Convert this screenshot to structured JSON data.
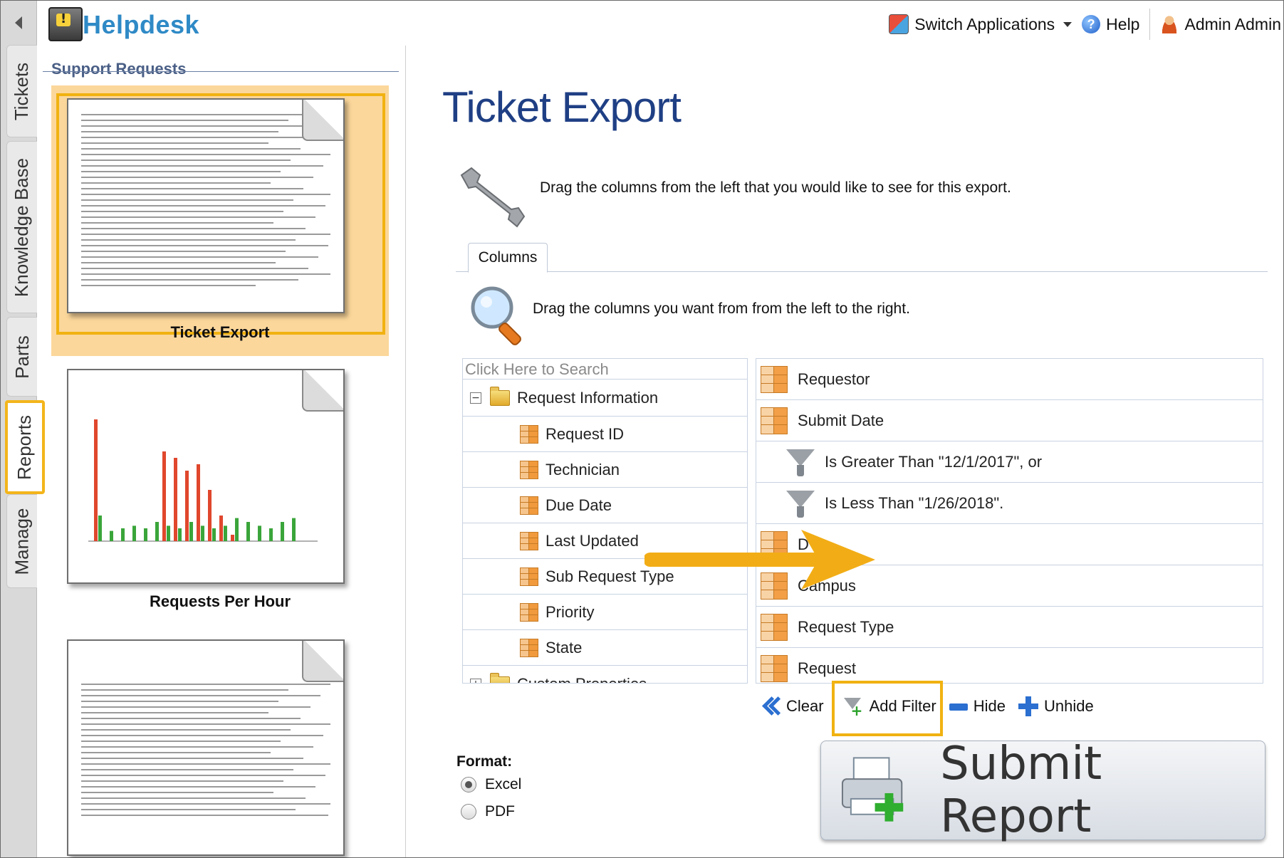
{
  "app": {
    "title": "Helpdesk"
  },
  "header": {
    "switch_applications": "Switch Applications",
    "help": "Help",
    "user": "Admin Admin"
  },
  "nav_tabs": [
    "Tickets",
    "Knowledge Base",
    "Parts",
    "Reports",
    "Manage"
  ],
  "active_tab": "Reports",
  "reports_pane": {
    "section_title": "Support Requests",
    "reports": [
      {
        "label": "Ticket Export",
        "selected": true
      },
      {
        "label": "Requests Per Hour",
        "selected": false
      },
      {
        "label": "",
        "selected": false
      }
    ]
  },
  "main": {
    "title": "Ticket Export",
    "instruction": "Drag the columns from the left that you would like to see for this export.",
    "tab_columns": "Columns",
    "columns_instruction": "Drag the columns you want from from the left to the right.",
    "search_placeholder": "Click Here to Search",
    "tree": {
      "group_expanded": "Request Information",
      "fields": [
        "Request ID",
        "Technician",
        "Due Date",
        "Last Updated",
        "Sub Request Type",
        "Priority",
        "State"
      ],
      "group_collapsed": "Custom Properties"
    },
    "selected_columns": {
      "requestor": "Requestor",
      "submit_date": "Submit Date",
      "filter1": "Is Greater Than \"12/1/2017\", or",
      "filter2": "Is Less Than \"1/26/2018\".",
      "hidden_row": "D",
      "campus": "Campus",
      "request_type": "Request Type",
      "request": "Request"
    },
    "actions": {
      "clear": "Clear",
      "add_filter": "Add Filter",
      "hide": "Hide",
      "unhide": "Unhide"
    },
    "format": {
      "label": "Format:",
      "options": [
        "Excel",
        "PDF"
      ],
      "selected": "Excel"
    },
    "submit": "Submit Report"
  },
  "colors": {
    "accent_highlight": "#f1b211",
    "title_blue": "#1f3f84",
    "logo_blue": "#2f8ac6",
    "arrow": "#f2ad16"
  },
  "chart_thumb": {
    "red_bars": [
      0.95,
      0,
      0,
      0,
      0,
      0,
      0.7,
      0.65,
      0.55,
      0.6,
      0.4,
      0.2,
      0.05,
      0,
      0,
      0,
      0,
      0
    ],
    "green_bars": [
      0.2,
      0.08,
      0.1,
      0.12,
      0.1,
      0.15,
      0.12,
      0.1,
      0.15,
      0.12,
      0.1,
      0.12,
      0.18,
      0.15,
      0.12,
      0.1,
      0.15,
      0.18
    ]
  }
}
